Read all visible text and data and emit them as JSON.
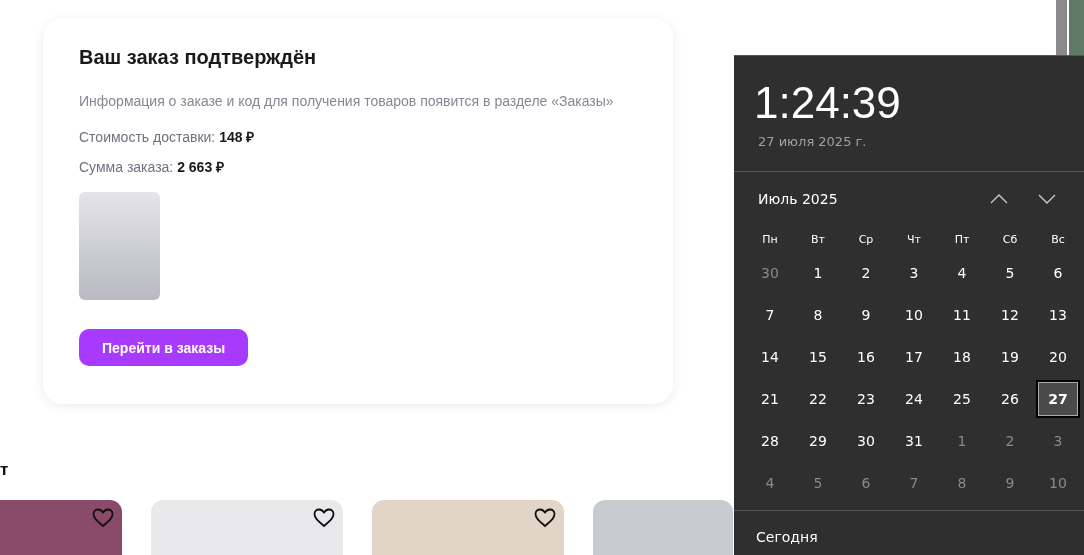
{
  "order_card": {
    "title": "Ваш заказ подтверждён",
    "info": "Информация о заказе и код для получения товаров появится в разделе «Заказы»",
    "summary": [
      {
        "label": "Стоимость доставки:",
        "value": "148 ₽"
      },
      {
        "label": "Сумма заказа:",
        "value": "2 663 ₽"
      }
    ],
    "button": "Перейти в заказы"
  },
  "recommendations": {
    "heading": "т",
    "products": [
      {
        "heart": true
      },
      {
        "heart": true
      },
      {
        "heart": true
      },
      {
        "heart": false
      }
    ]
  },
  "calendar_flyout": {
    "time": "1:24:39",
    "date": "27 июля 2025 г.",
    "month": "Июль 2025",
    "weekdays": [
      "Пн",
      "Вт",
      "Ср",
      "Чт",
      "Пт",
      "Сб",
      "Вс"
    ],
    "days": [
      {
        "label": "30",
        "in_month": false,
        "selected": false
      },
      {
        "label": "1",
        "in_month": true,
        "selected": false
      },
      {
        "label": "2",
        "in_month": true,
        "selected": false
      },
      {
        "label": "3",
        "in_month": true,
        "selected": false
      },
      {
        "label": "4",
        "in_month": true,
        "selected": false
      },
      {
        "label": "5",
        "in_month": true,
        "selected": false
      },
      {
        "label": "6",
        "in_month": true,
        "selected": false
      },
      {
        "label": "7",
        "in_month": true,
        "selected": false
      },
      {
        "label": "8",
        "in_month": true,
        "selected": false
      },
      {
        "label": "9",
        "in_month": true,
        "selected": false
      },
      {
        "label": "10",
        "in_month": true,
        "selected": false
      },
      {
        "label": "11",
        "in_month": true,
        "selected": false
      },
      {
        "label": "12",
        "in_month": true,
        "selected": false
      },
      {
        "label": "13",
        "in_month": true,
        "selected": false
      },
      {
        "label": "14",
        "in_month": true,
        "selected": false
      },
      {
        "label": "15",
        "in_month": true,
        "selected": false
      },
      {
        "label": "16",
        "in_month": true,
        "selected": false
      },
      {
        "label": "17",
        "in_month": true,
        "selected": false
      },
      {
        "label": "18",
        "in_month": true,
        "selected": false
      },
      {
        "label": "19",
        "in_month": true,
        "selected": false
      },
      {
        "label": "20",
        "in_month": true,
        "selected": false
      },
      {
        "label": "21",
        "in_month": true,
        "selected": false
      },
      {
        "label": "22",
        "in_month": true,
        "selected": false
      },
      {
        "label": "23",
        "in_month": true,
        "selected": false
      },
      {
        "label": "24",
        "in_month": true,
        "selected": false
      },
      {
        "label": "25",
        "in_month": true,
        "selected": false
      },
      {
        "label": "26",
        "in_month": true,
        "selected": false
      },
      {
        "label": "27",
        "in_month": true,
        "selected": true
      },
      {
        "label": "28",
        "in_month": true,
        "selected": false
      },
      {
        "label": "29",
        "in_month": true,
        "selected": false
      },
      {
        "label": "30",
        "in_month": true,
        "selected": false
      },
      {
        "label": "31",
        "in_month": true,
        "selected": false
      },
      {
        "label": "1",
        "in_month": false,
        "selected": false
      },
      {
        "label": "2",
        "in_month": false,
        "selected": false
      },
      {
        "label": "3",
        "in_month": false,
        "selected": false
      },
      {
        "label": "4",
        "in_month": false,
        "selected": false
      },
      {
        "label": "5",
        "in_month": false,
        "selected": false
      },
      {
        "label": "6",
        "in_month": false,
        "selected": false
      },
      {
        "label": "7",
        "in_month": false,
        "selected": false
      },
      {
        "label": "8",
        "in_month": false,
        "selected": false
      },
      {
        "label": "9",
        "in_month": false,
        "selected": false
      },
      {
        "label": "10",
        "in_month": false,
        "selected": false
      }
    ],
    "today_button": "Сегодня"
  }
}
